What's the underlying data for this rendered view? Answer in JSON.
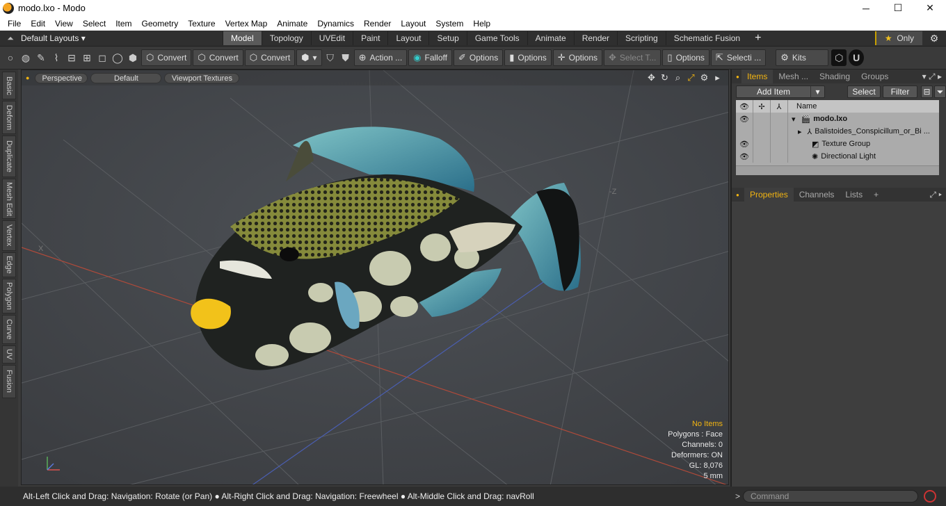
{
  "window": {
    "title": "modo.lxo - Modo",
    "min": "─",
    "max": "☐",
    "close": "✕"
  },
  "menu": [
    "File",
    "Edit",
    "View",
    "Select",
    "Item",
    "Geometry",
    "Texture",
    "Vertex Map",
    "Animate",
    "Dynamics",
    "Render",
    "Layout",
    "System",
    "Help"
  ],
  "layouts": {
    "label": "Default Layouts ▾",
    "tabs": [
      "Model",
      "Topology",
      "UVEdit",
      "Paint",
      "Layout",
      "Setup",
      "Game Tools",
      "Animate",
      "Render",
      "Scripting",
      "Schematic Fusion"
    ],
    "active": "Model",
    "plus": "+",
    "only": "Only",
    "star": "★"
  },
  "toolbar": {
    "convert1": "Convert",
    "convert2": "Convert",
    "convert3": "Convert",
    "action": "Action ...",
    "falloff": "Falloff",
    "options1": "Options",
    "options2": "Options",
    "options3": "Options",
    "select_t": "Select T...",
    "options4": "Options",
    "selecti": "Selecti ...",
    "kits": "Kits"
  },
  "left_tabs": [
    "Basic",
    "Deform",
    "Duplicate",
    "Mesh Edit",
    "Vertex",
    "Edge",
    "Polygon",
    "Curve",
    "UV",
    "Fusion"
  ],
  "viewport": {
    "view": "Perspective",
    "shading": "Default",
    "textures": "Viewport Textures",
    "axis_x": "X",
    "axis_z": "-Z",
    "info": {
      "items": "No Items",
      "polygons": "Polygons : Face",
      "channels": "Channels: 0",
      "deformers": "Deformers: ON",
      "gl": "GL: 8,076",
      "scale": "5 mm"
    }
  },
  "status": "Alt-Left Click and Drag: Navigation: Rotate (or Pan) ● Alt-Right Click and Drag: Navigation: Freewheel ● Alt-Middle Click and Drag: navRoll",
  "items_panel": {
    "tabs": [
      "Items",
      "Mesh ...",
      "Shading",
      "Groups"
    ],
    "active": "Items",
    "add_item": "Add Item",
    "select": "Select",
    "filter": "Filter",
    "name_header": "Name",
    "tree": [
      {
        "name": "modo.lxo"
      },
      {
        "name": "Balistoides_Conspicillum_or_Bi ..."
      },
      {
        "name": "Texture Group"
      },
      {
        "name": "Directional Light"
      }
    ]
  },
  "props_panel": {
    "tabs": [
      "Properties",
      "Channels",
      "Lists"
    ],
    "active": "Properties",
    "plus": "+"
  },
  "command": {
    "placeholder": "Command"
  }
}
